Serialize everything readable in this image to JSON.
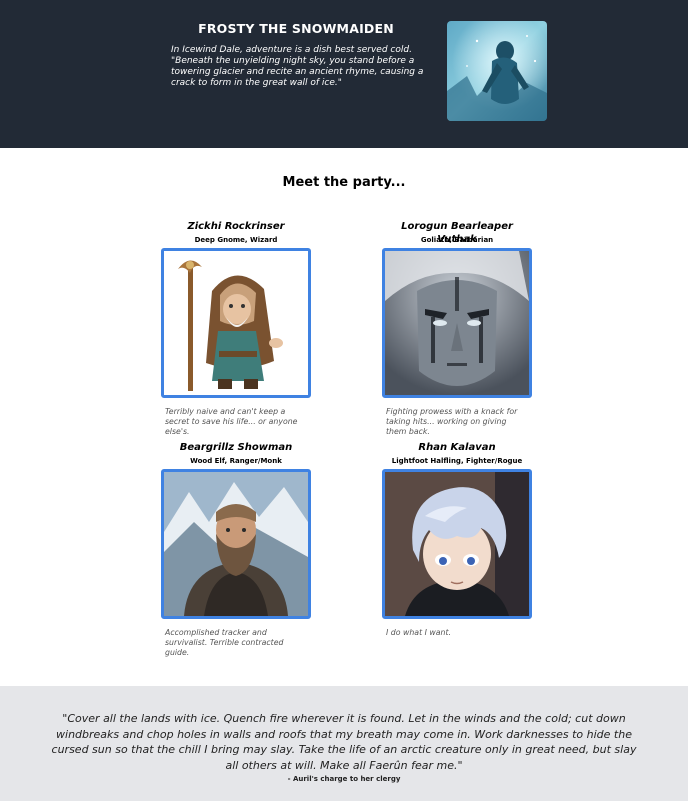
{
  "header": {
    "title": "FROSTY THE SNOWMAIDEN",
    "intro_line1": "In Icewind Dale, adventure is a dish best served cold.",
    "intro_line2": "\"Beneath the unyielding night sky, you stand before a towering glacier and recite an ancient rhyme, causing a crack to form in the great wall of ice.\""
  },
  "main": {
    "heading": "Meet the party...",
    "party": [
      {
        "name": "Zickhi Rockrinser",
        "subtitle": "Deep Gnome, Wizard",
        "description": "Terribly naive and can't keep a secret to save his life... or anyone else's."
      },
      {
        "name": "Lorogun Bearleaper Vuthak",
        "subtitle": "Goliath, Barbarian",
        "description": "Fighting prowess with a knack for taking hits... working on giving them back."
      },
      {
        "name": "Beargrillz Showman",
        "subtitle": "Wood Elf, Ranger/Monk",
        "description": "Accomplished tracker and survivalist. Terrible contracted guide."
      },
      {
        "name": "Rhan Kalavan",
        "subtitle": "Lightfoot Halfling, Fighter/Rogue",
        "description": "I do what I want."
      }
    ]
  },
  "footer": {
    "quote": "\"Cover all the lands with ice. Quench fire wherever it is found. Let in the winds and the cold; cut down windbreaks and chop holes in walls and roofs that my breath may come in. Work darknesses to hide the cursed sun so that the chill I bring may slay. Take the life of an arctic creature only in great need, but slay all others at will. Make all Faerûn fear me.\"",
    "attribution": "- Auril's charge to her clergy"
  },
  "colors": {
    "header_bg": "#222a36",
    "portrait_border": "#3f82e2",
    "footer_bg": "#e5e6e9"
  }
}
